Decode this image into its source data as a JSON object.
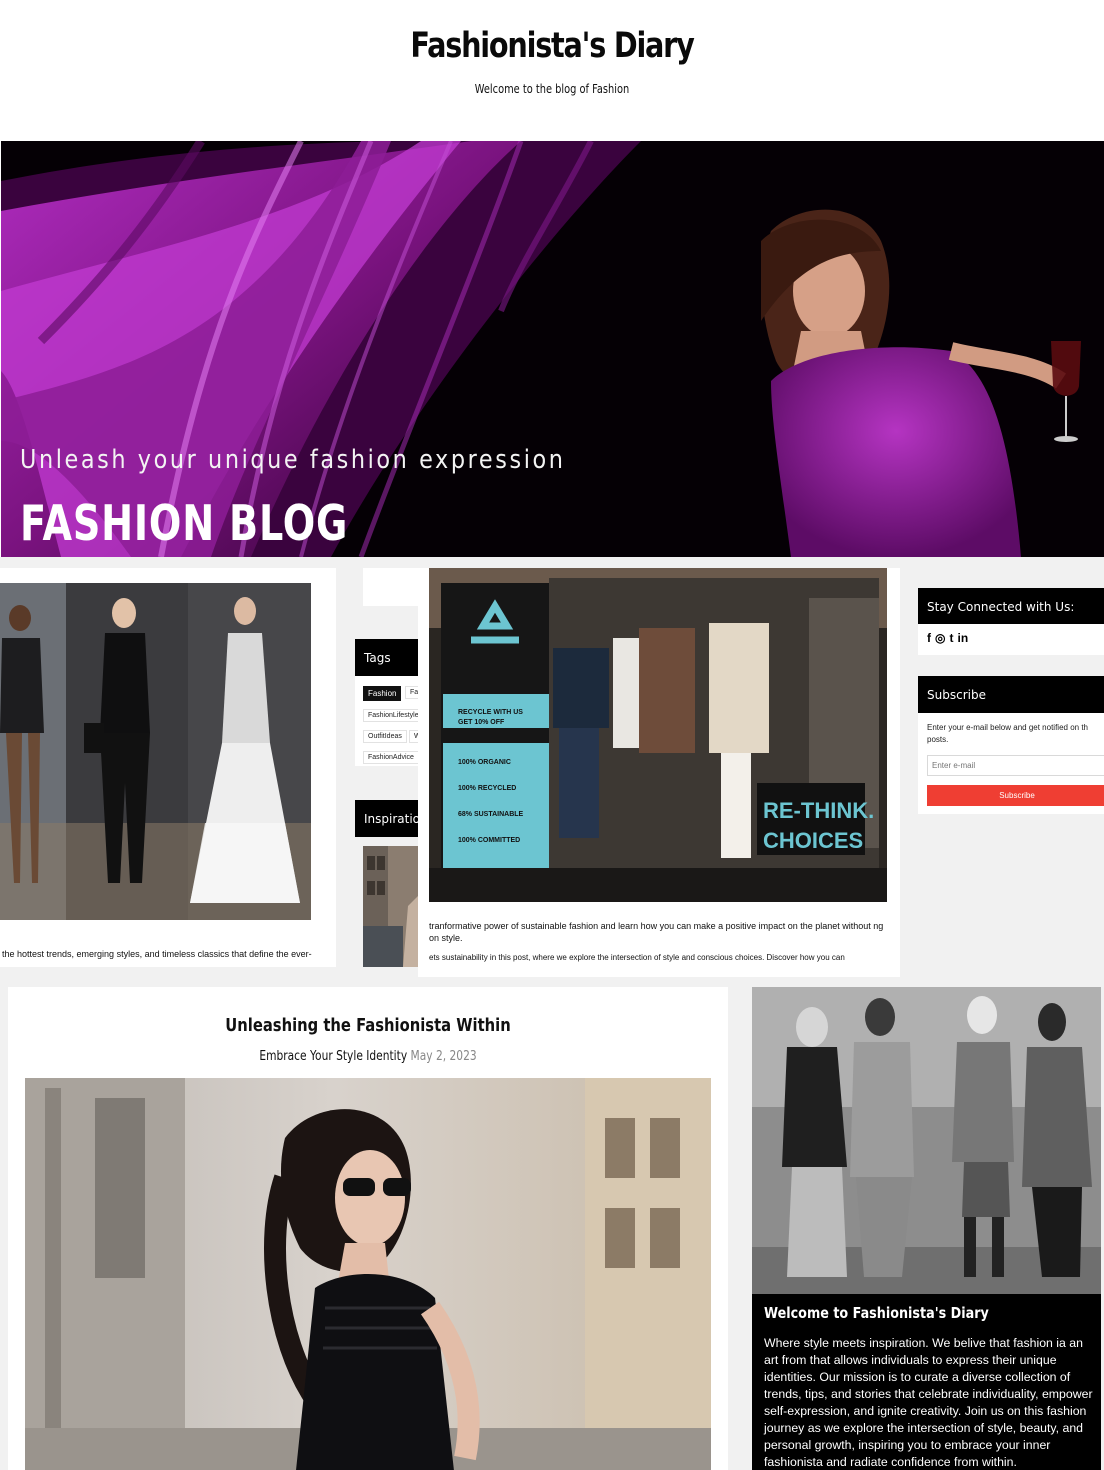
{
  "header": {
    "title": "Fashionista's Diary",
    "tagline": "Welcome to the blog of Fashion"
  },
  "hero": {
    "subtitle": "Unleash your unique fashion expression",
    "title": "FASHION BLOG",
    "accent_color": "#8e1a9c"
  },
  "featured_left": {
    "excerpt": "the hottest trends, emerging styles, and timeless classics that define the ever-"
  },
  "tags_widget": {
    "title": "Tags",
    "tags": [
      "Fashion",
      "Fa",
      "FashionLifestyle",
      "OutfitIdeas",
      "W",
      "FashionAdvice"
    ]
  },
  "inspiration_widget": {
    "title": "Inspiration"
  },
  "featured_mid": {
    "sign_lines": [
      "RECYCLE WITH US",
      "GET 10% OFF",
      "100% ORGANIC",
      "100% RECYCLED",
      "68% SUSTAINABLE",
      "100% COMMITTED"
    ],
    "window_text": [
      "RE-THINK.",
      "CHOICES"
    ],
    "excerpt_1": "tranformative power of sustainable fashion and learn how you can make a positive impact on the planet without ng on style.",
    "excerpt_2": "ets sustainability in this post, where we explore the intersection of style and conscious choices. Discover how you can"
  },
  "sidebar": {
    "connect_title": "Stay Connected with Us:",
    "social_icons": [
      "facebook-icon",
      "instagram-icon",
      "twitter-icon",
      "linkedin-icon"
    ],
    "social_glyphs": [
      "f",
      "◎",
      "t",
      "in"
    ],
    "subscribe_title": "Subscribe",
    "subscribe_text": "Enter your e-mail below and get notified on th posts.",
    "email_placeholder": "Enter e-mail",
    "subscribe_button": "Subscribe",
    "button_color": "#ef3e33"
  },
  "post": {
    "title": "Unleashing the Fashionista Within",
    "subtitle": "Embrace Your Style Identity",
    "date": "May 2, 2023"
  },
  "welcome": {
    "title": "Welcome to Fashionista's Diary",
    "text": "Where style meets inspiration. We belive that fashion ia an art from that allows individuals to express their unique identities. Our mission is to curate a diverse collection of trends, tips, and stories that celebrate individuality, empower self-expression, and ignite creativity. Join us on this fashion journey as we explore the intersection of style, beauty, and personal growth, inspiring you to embrace your inner fashionista and radiate confidence from within."
  }
}
